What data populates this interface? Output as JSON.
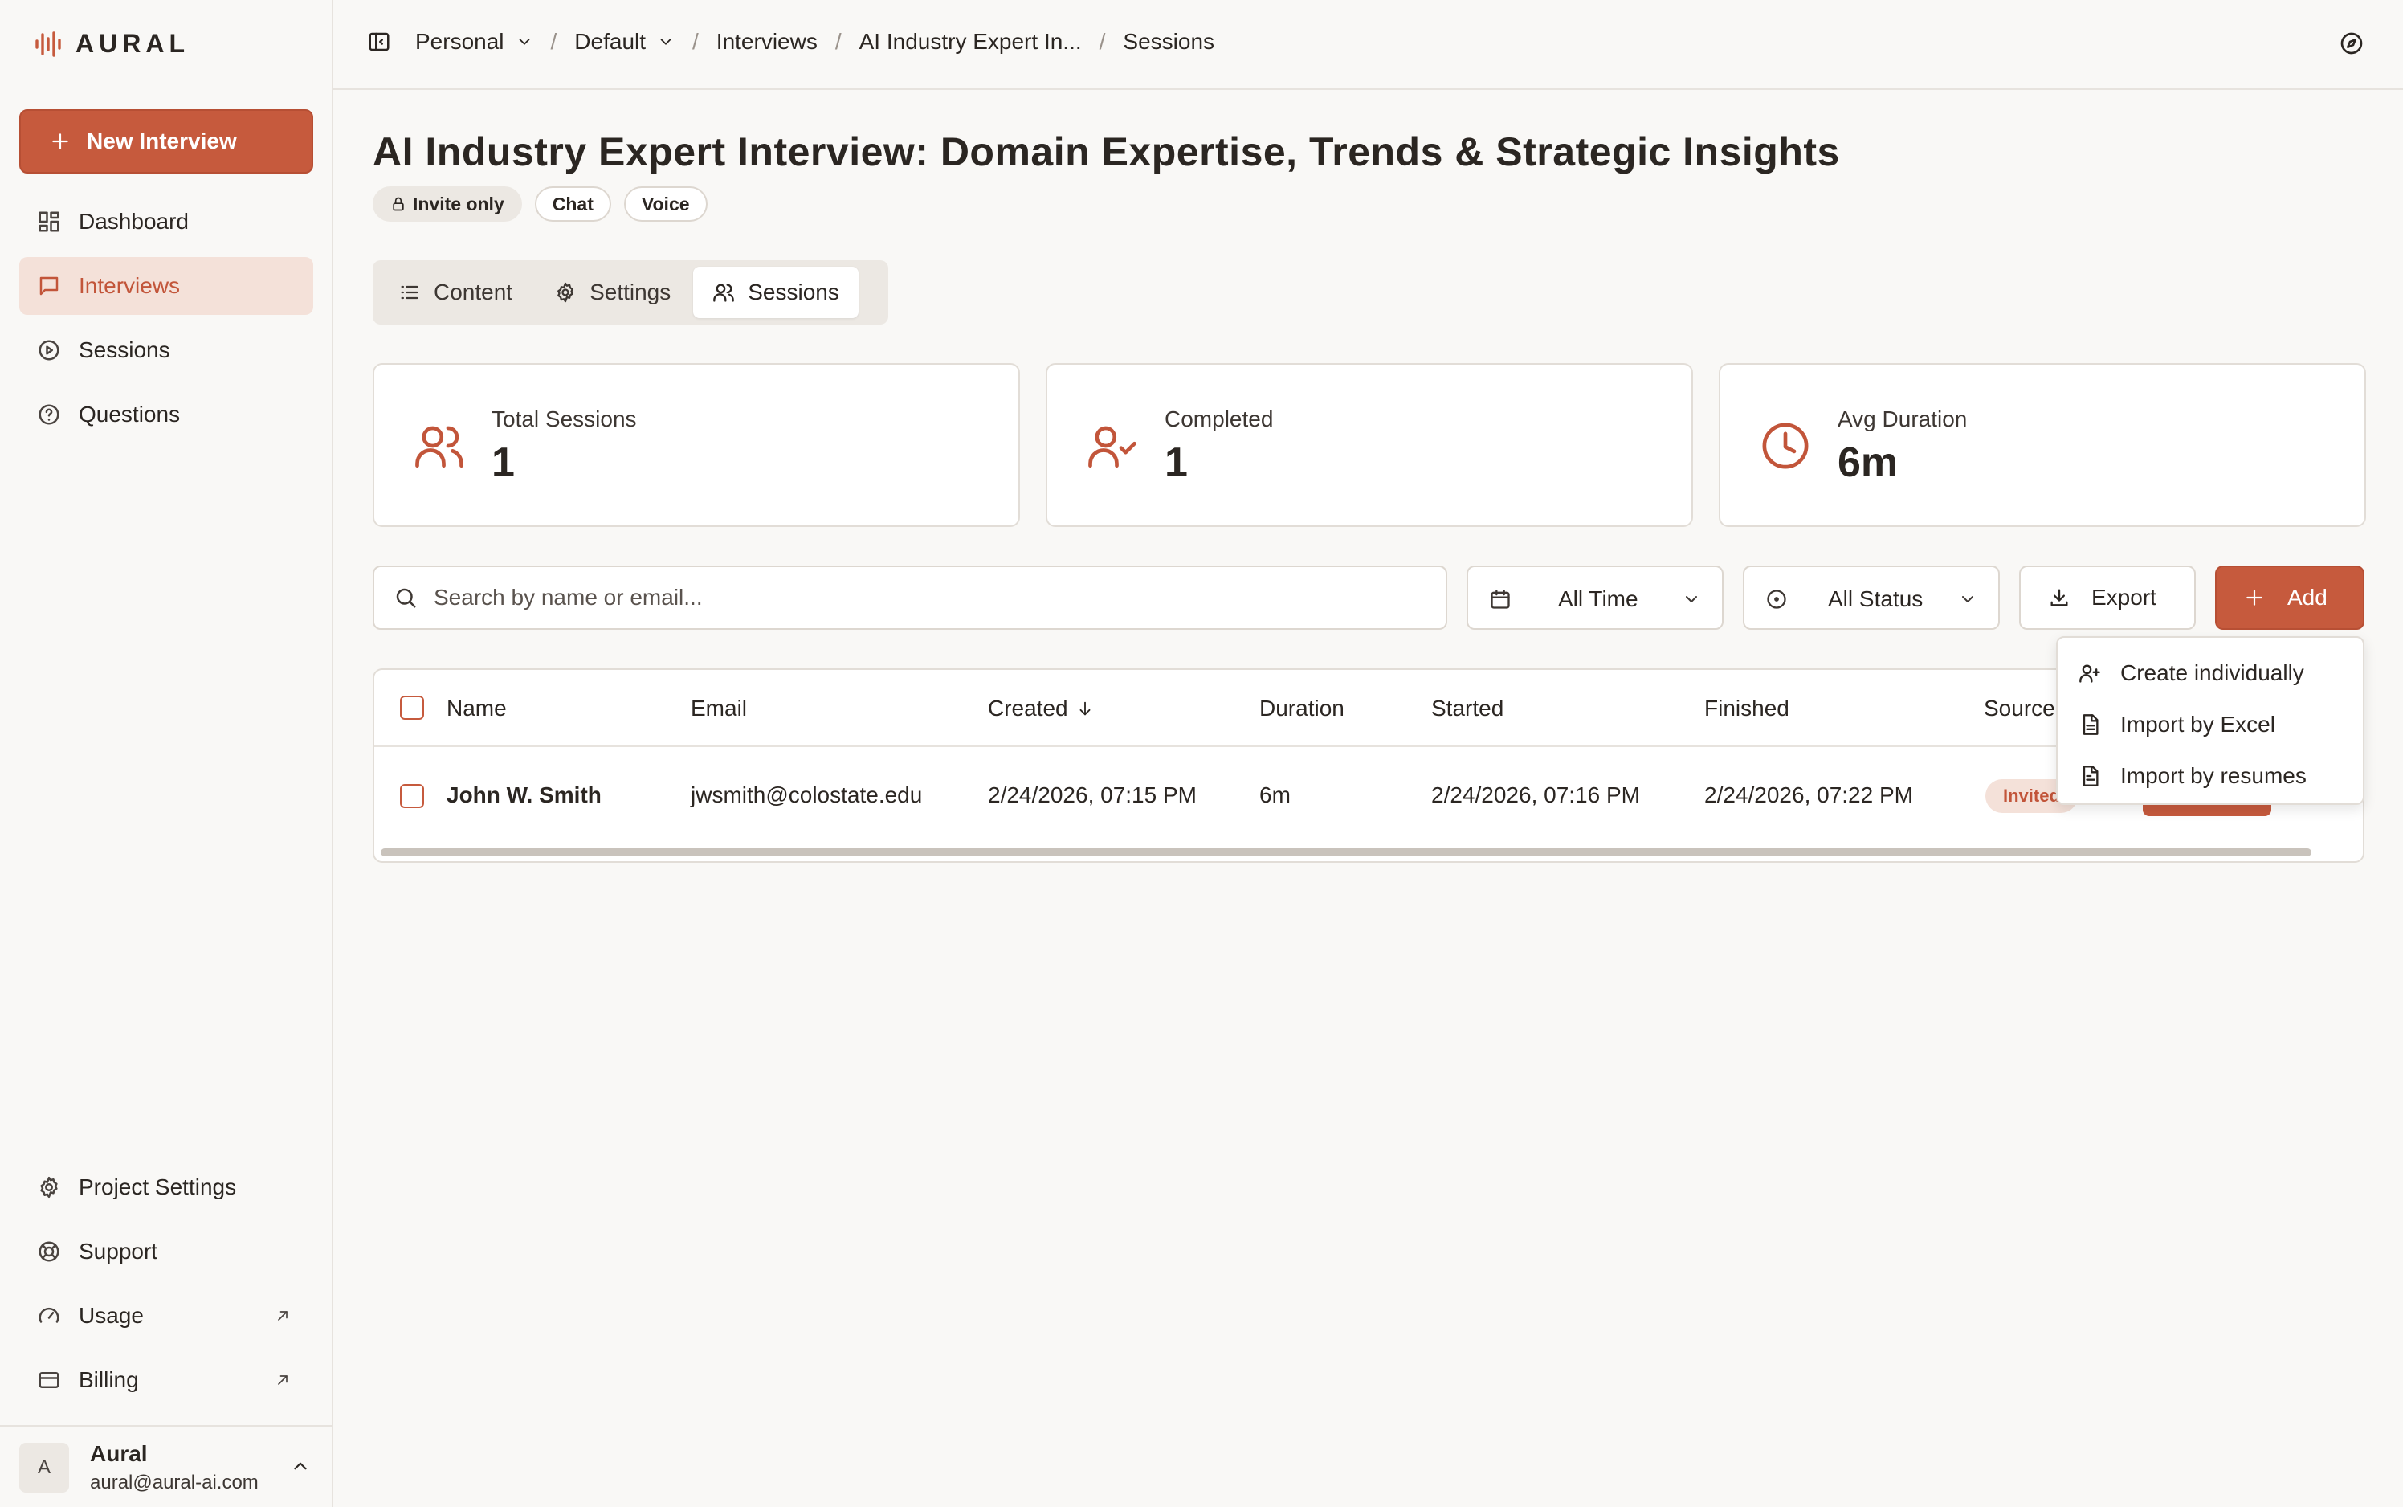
{
  "brand": {
    "name": "AURAL",
    "accent": "#c65a3d"
  },
  "sidebar": {
    "new_button": "New Interview",
    "items": [
      {
        "label": "Dashboard",
        "icon": "dashboard-icon"
      },
      {
        "label": "Interviews",
        "icon": "chat-square-icon",
        "active": true
      },
      {
        "label": "Sessions",
        "icon": "play-circle-icon"
      },
      {
        "label": "Questions",
        "icon": "help-circle-icon"
      }
    ],
    "bottom_items": [
      {
        "label": "Project Settings",
        "icon": "gear-icon"
      },
      {
        "label": "Support",
        "icon": "lifebuoy-icon"
      },
      {
        "label": "Usage",
        "icon": "gauge-icon",
        "external": true
      },
      {
        "label": "Billing",
        "icon": "credit-card-icon",
        "external": true
      }
    ],
    "user": {
      "initial": "A",
      "name": "Aural",
      "email": "aural@aural-ai.com"
    }
  },
  "breadcrumb": {
    "workspace": "Personal",
    "project": "Default",
    "section": "Interviews",
    "interview": "AI Industry Expert In...",
    "page": "Sessions"
  },
  "page": {
    "title": "AI Industry Expert Interview: Domain Expertise, Trends & Strategic Insights",
    "badges": {
      "access": "Invite only",
      "mode1": "Chat",
      "mode2": "Voice"
    },
    "tabs": {
      "content": "Content",
      "settings": "Settings",
      "sessions": "Sessions"
    }
  },
  "stats": {
    "total": {
      "label": "Total Sessions",
      "value": "1"
    },
    "completed": {
      "label": "Completed",
      "value": "1"
    },
    "avg": {
      "label": "Avg Duration",
      "value": "6m"
    }
  },
  "toolbar": {
    "search_placeholder": "Search by name or email...",
    "time_filter": "All Time",
    "status_filter": "All Status",
    "export": "Export",
    "add": "Add"
  },
  "table": {
    "headers": {
      "name": "Name",
      "email": "Email",
      "created": "Created",
      "duration": "Duration",
      "started": "Started",
      "finished": "Finished",
      "source": "Source"
    },
    "rows": [
      {
        "name": "John W. Smith",
        "email": "jwsmith@colostate.edu",
        "created": "2/24/2026, 07:15 PM",
        "duration": "6m",
        "started": "2/24/2026, 07:16 PM",
        "finished": "2/24/2026, 07:22 PM",
        "source": "Invited"
      }
    ]
  },
  "add_menu": {
    "create": "Create individually",
    "excel": "Import by Excel",
    "resumes": "Import by resumes"
  }
}
